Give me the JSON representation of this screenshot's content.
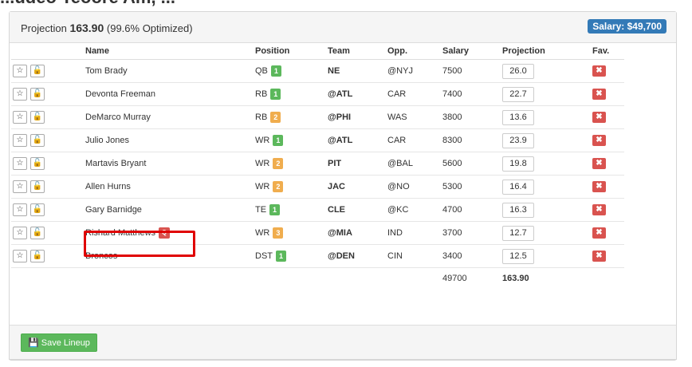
{
  "page_title_fragment": "...udeo Teoore Am, ... ",
  "summary": {
    "label": "Projection",
    "total": "163.90",
    "optimized": "(99.6% Optimized)"
  },
  "salary_badge": "Salary: $49,700",
  "columns": {
    "name": "Name",
    "position": "Position",
    "team": "Team",
    "opp": "Opp.",
    "salary": "Salary",
    "projection": "Projection",
    "fav": "Fav."
  },
  "players": [
    {
      "name": "Tom Brady",
      "pos": "QB",
      "rank": "1",
      "rank_color": "#5cb85c",
      "team": "NE",
      "opp": "@NYJ",
      "salary": "7500",
      "proj": "26.0"
    },
    {
      "name": "Devonta Freeman",
      "pos": "RB",
      "rank": "1",
      "rank_color": "#5cb85c",
      "team": "@ATL",
      "opp": "CAR",
      "salary": "7400",
      "proj": "22.7"
    },
    {
      "name": "DeMarco Murray",
      "pos": "RB",
      "rank": "2",
      "rank_color": "#f0ad4e",
      "team": "@PHI",
      "opp": "WAS",
      "salary": "3800",
      "proj": "13.6"
    },
    {
      "name": "Julio Jones",
      "pos": "WR",
      "rank": "1",
      "rank_color": "#5cb85c",
      "team": "@ATL",
      "opp": "CAR",
      "salary": "8300",
      "proj": "23.9"
    },
    {
      "name": "Martavis Bryant",
      "pos": "WR",
      "rank": "2",
      "rank_color": "#f0ad4e",
      "team": "PIT",
      "opp": "@BAL",
      "salary": "5600",
      "proj": "19.8"
    },
    {
      "name": "Allen Hurns",
      "pos": "WR",
      "rank": "2",
      "rank_color": "#f0ad4e",
      "team": "JAC",
      "opp": "@NO",
      "salary": "5300",
      "proj": "16.4"
    },
    {
      "name": "Gary Barnidge",
      "pos": "TE",
      "rank": "1",
      "rank_color": "#5cb85c",
      "team": "CLE",
      "opp": "@KC",
      "salary": "4700",
      "proj": "16.3"
    },
    {
      "name": "Rishard Matthews",
      "pos": "WR",
      "rank": "3",
      "rank_color": "#f0ad4e",
      "team": "@MIA",
      "opp": "IND",
      "salary": "3700",
      "proj": "12.7",
      "status": "Q"
    },
    {
      "name": "Broncos",
      "pos": "DST",
      "rank": "1",
      "rank_color": "#5cb85c",
      "team": "@DEN",
      "opp": "CIN",
      "salary": "3400",
      "proj": "12.5"
    }
  ],
  "totals": {
    "salary": "49700",
    "projection": "163.90"
  },
  "footer": {
    "save_label": "Save Lineup"
  },
  "icons": {
    "star": "star-icon",
    "lock": "lock-icon",
    "delete": "close-icon",
    "save": "floppy-icon"
  }
}
